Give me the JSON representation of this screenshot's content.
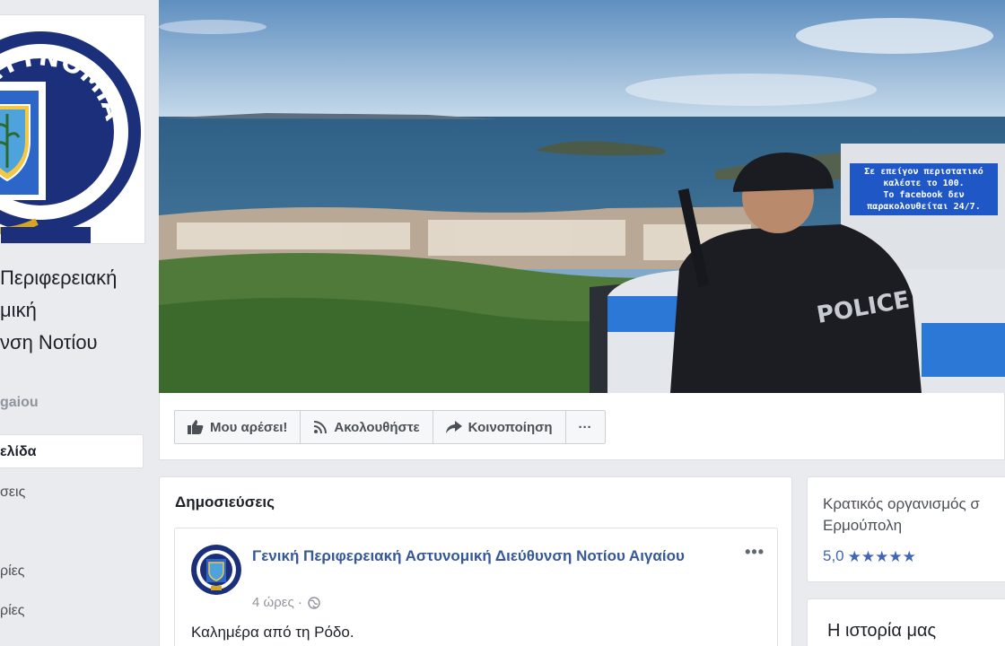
{
  "page": {
    "name_lines": [
      "Περιφερειακή",
      "μική",
      "νση Νοτίου"
    ],
    "handle": "gaiou"
  },
  "nav": {
    "items": [
      {
        "label": "ελίδα",
        "active": true
      },
      {
        "label": "σεις",
        "active": false
      },
      {
        "label": "ρίες",
        "active": false
      },
      {
        "label": "ρίες",
        "active": false
      }
    ]
  },
  "cover": {
    "overlay_lines": [
      "Σε επείγον περιστατικό",
      "καλέστε το 100.",
      "Το facebook δεν",
      "παρακολουθείται 24/7."
    ],
    "police_text": "POLICE",
    "logo_text": "Η ΑΣΤΥΝΟΜΙΑ"
  },
  "actions": {
    "like_label": "Μου αρέσει!",
    "follow_label": "Ακολουθήστε",
    "share_label": "Κοινοποίηση",
    "more_label": "···"
  },
  "posts": {
    "section_title": "Δημοσιεύσεις",
    "post": {
      "author": "Γενική Περιφερειακή Αστυνομική Διεύθυνση Νοτίου Αιγαίου",
      "time": "4 ώρες ·",
      "more": "•••",
      "text": "Καλημέρα από τη Ρόδο."
    }
  },
  "about": {
    "category_line1": "Κρατικός οργανισμός σ",
    "category_line2": "Ερμούπολη",
    "rating": "5,0",
    "stars": 5
  },
  "story": {
    "title": "Η ιστορία μας"
  },
  "colors": {
    "accent": "#4267b2",
    "link": "#365899",
    "background": "#e9ebee",
    "overlay_blue": "#1f57c7"
  }
}
